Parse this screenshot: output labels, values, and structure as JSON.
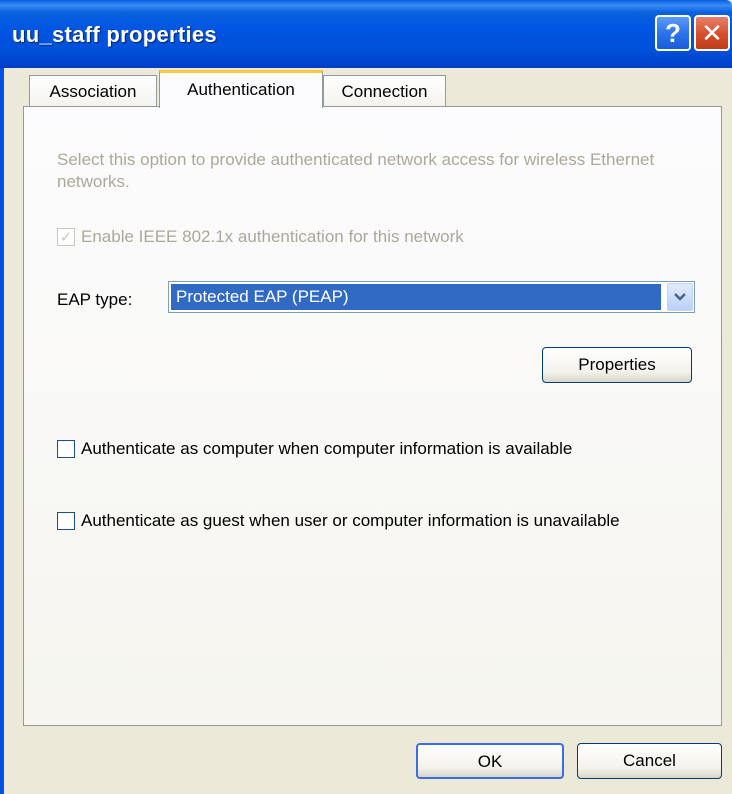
{
  "window": {
    "title": "uu_staff properties",
    "help_label": "?",
    "close_label": "✕"
  },
  "tabs": [
    {
      "label": "Association",
      "active": false
    },
    {
      "label": "Authentication",
      "active": true
    },
    {
      "label": "Connection",
      "active": false
    }
  ],
  "authentication": {
    "description": "Select this option to provide authenticated network access for wireless Ethernet networks.",
    "enable_label": "Enable IEEE 802.1x authentication for this network",
    "enable_checked": true,
    "enable_disabled": true,
    "eap_label": "EAP type:",
    "eap_value": "Protected EAP (PEAP)",
    "properties_label": "Properties",
    "auth_computer_label": "Authenticate as computer when computer information is available",
    "auth_computer_checked": false,
    "auth_guest_label": "Authenticate as guest when user or computer information is unavailable",
    "auth_guest_checked": false
  },
  "footer": {
    "ok_label": "OK",
    "cancel_label": "Cancel"
  },
  "colors": {
    "titlebar": "#0054e3",
    "selection": "#316ac5",
    "active_tab_accent": "#ffc83c",
    "disabled_text": "#aca899"
  }
}
